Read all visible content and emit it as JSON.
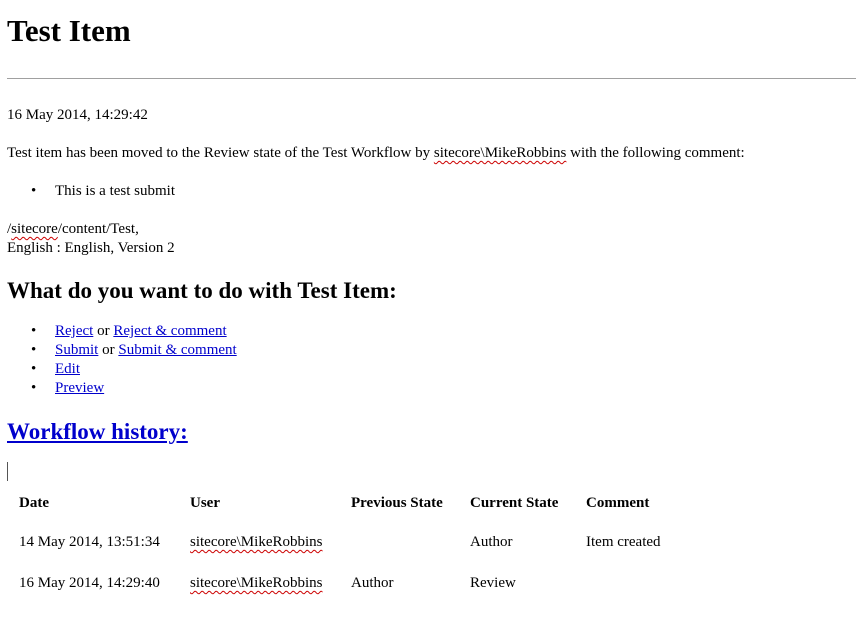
{
  "title": "Test Item",
  "date": "16 May 2014, 14:29:42",
  "message": {
    "prefix": "Test item has been moved to the Review state of the Test Workflow by ",
    "user": "sitecore\\MikeRobbins",
    "suffix": " with the following comment:"
  },
  "comments": [
    "This is a test submit"
  ],
  "item_path": {
    "prefix": "/",
    "sitecore": "sitecore",
    "rest": "/content/Test,"
  },
  "language_line": "English : English, Version 2",
  "question": "What do you want to do with Test Item:",
  "actions": {
    "reject": "Reject",
    "or1": " or ",
    "reject_comment": "Reject & comment",
    "submit": "Submit",
    "or2": " or ",
    "submit_comment": "Submit & comment",
    "edit": "Edit",
    "preview": "Preview"
  },
  "history_heading": "Workflow history:",
  "history_table": {
    "headers": [
      "Date",
      "User",
      "Previous State",
      "Current State",
      "Comment"
    ],
    "rows": [
      [
        "14 May 2014, 13:51:34",
        "sitecore\\MikeRobbins",
        "",
        "Author",
        "Item created"
      ],
      [
        "16 May 2014, 14:29:40",
        "sitecore\\MikeRobbins",
        "Author",
        "Review",
        ""
      ]
    ]
  }
}
